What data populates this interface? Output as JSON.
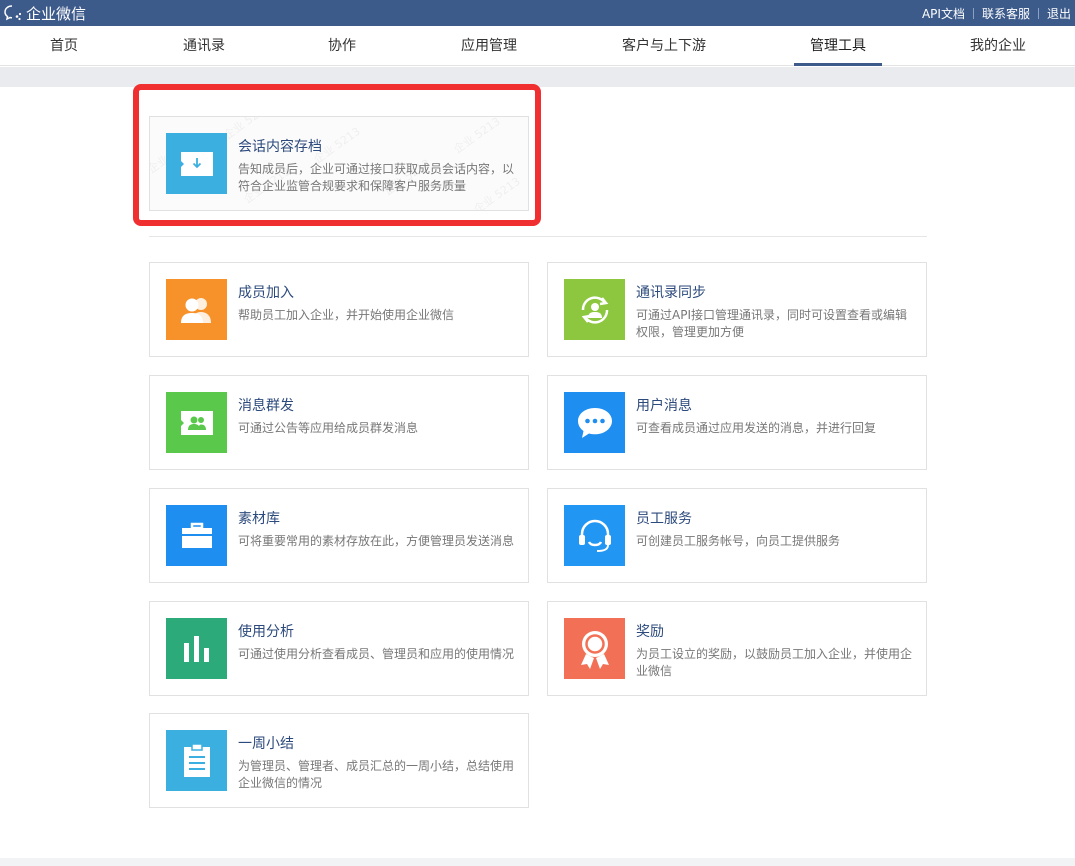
{
  "topbar": {
    "brand": "企业微信",
    "links": [
      "API文档",
      "联系客服",
      "退出"
    ]
  },
  "nav": {
    "items": [
      "首页",
      "通讯录",
      "协作",
      "应用管理",
      "客户与上下游",
      "管理工具",
      "我的企业"
    ],
    "active": "管理工具"
  },
  "featured": {
    "title": "会话内容存档",
    "desc": "告知成员后，企业可通过接口获取成员会话内容，以符合企业监管合规要求和保障客户服务质量",
    "watermark": "企业 5213"
  },
  "tools": [
    {
      "title": "成员加入",
      "desc": "帮助员工加入企业，并开始使用企业微信",
      "icon": "members-icon",
      "color": "#f7922b"
    },
    {
      "title": "通讯录同步",
      "desc": "可通过API接口管理通讯录，同时可设置查看或编辑权限，管理更加方便",
      "icon": "sync-icon",
      "color": "#8dc63f"
    },
    {
      "title": "消息群发",
      "desc": "可通过公告等应用给成员群发消息",
      "icon": "broadcast-icon",
      "color": "#5ac94b"
    },
    {
      "title": "用户消息",
      "desc": "可查看成员通过应用发送的消息，并进行回复",
      "icon": "chat-icon",
      "color": "#1e8ef0"
    },
    {
      "title": "素材库",
      "desc": "可将重要常用的素材存放在此，方便管理员发送消息",
      "icon": "material-icon",
      "color": "#1e8ef0"
    },
    {
      "title": "员工服务",
      "desc": "可创建员工服务帐号，向员工提供服务",
      "icon": "service-icon",
      "color": "#2196f3"
    },
    {
      "title": "使用分析",
      "desc": "可通过使用分析查看成员、管理员和应用的使用情况",
      "icon": "analytics-icon",
      "color": "#2daa7a"
    },
    {
      "title": "奖励",
      "desc": "为员工设立的奖励，以鼓励员工加入企业，并使用企业微信",
      "icon": "award-icon",
      "color": "#f27156"
    },
    {
      "title": "一周小结",
      "desc": "为管理员、管理者、成员汇总的一周小结，总结使用企业微信的情况",
      "icon": "summary-icon",
      "color": "#3bb0e0"
    }
  ],
  "colors": {
    "topbar": "#3c5a8a",
    "highlight": "#f03030",
    "title": "#2c4a7c"
  }
}
